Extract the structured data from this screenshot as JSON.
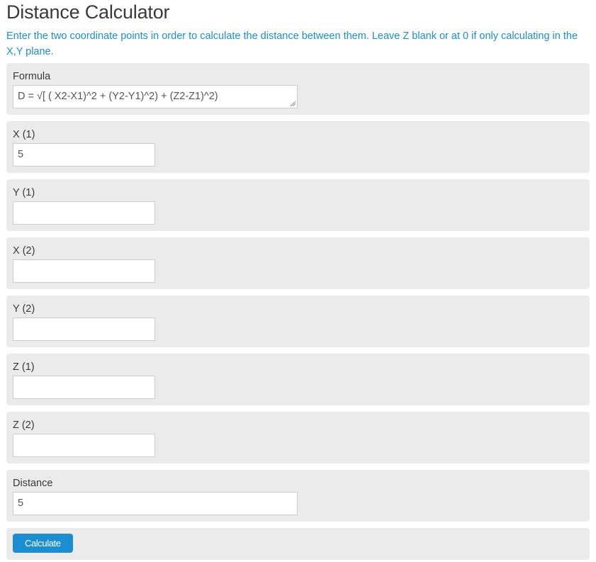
{
  "title": "Distance Calculator",
  "intro": "Enter the two coordinate points in order to calculate the distance between them. Leave Z blank or at 0 if only calculating in the X,Y plane.",
  "formula": {
    "label": "Formula",
    "value": "D = √[ ( X2-X1)^2 + (Y2-Y1)^2) + (Z2-Z1)^2)"
  },
  "fields": {
    "x1": {
      "label": "X (1)",
      "value": "5"
    },
    "y1": {
      "label": "Y (1)",
      "value": ""
    },
    "x2": {
      "label": "X (2)",
      "value": ""
    },
    "y2": {
      "label": "Y (2)",
      "value": ""
    },
    "z1": {
      "label": "Z (1)",
      "value": ""
    },
    "z2": {
      "label": "Z (2)",
      "value": ""
    }
  },
  "distance": {
    "label": "Distance",
    "value": "5"
  },
  "calculate_label": "Calculate",
  "colors": {
    "intro_text": "#1b8fc9",
    "panel_bg": "#ebebeb",
    "button_bg": "#1a8ed1"
  }
}
